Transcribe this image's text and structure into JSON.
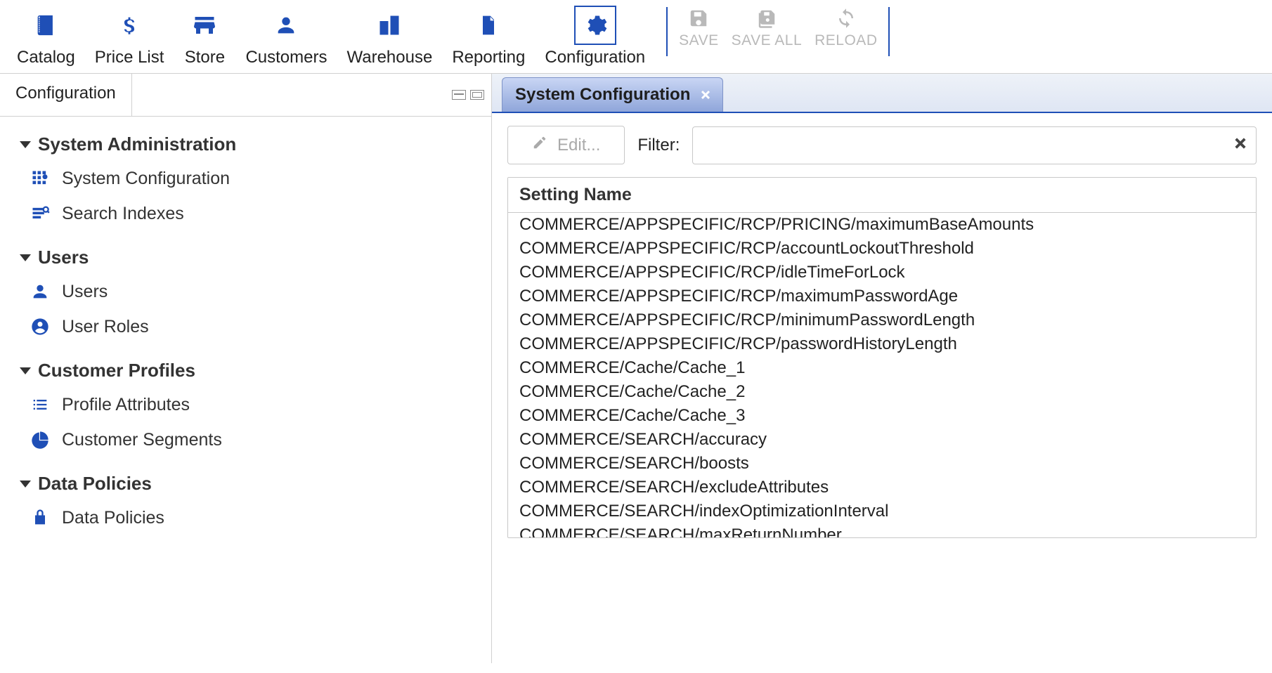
{
  "topnav": {
    "items": [
      {
        "label": "Catalog",
        "icon": "catalog-icon"
      },
      {
        "label": "Price List",
        "icon": "dollar-icon"
      },
      {
        "label": "Store",
        "icon": "store-icon"
      },
      {
        "label": "Customers",
        "icon": "person-icon"
      },
      {
        "label": "Warehouse",
        "icon": "building-icon"
      },
      {
        "label": "Reporting",
        "icon": "document-icon"
      },
      {
        "label": "Configuration",
        "icon": "gear-icon",
        "active": true
      }
    ]
  },
  "actions": {
    "save": "SAVE",
    "save_all": "SAVE ALL",
    "reload": "RELOAD"
  },
  "left": {
    "tab_label": "Configuration",
    "sections": [
      {
        "label": "System Administration",
        "items": [
          {
            "label": "System Configuration",
            "icon": "grid-gear-icon"
          },
          {
            "label": "Search Indexes",
            "icon": "index-search-icon"
          }
        ]
      },
      {
        "label": "Users",
        "items": [
          {
            "label": "Users",
            "icon": "person-icon"
          },
          {
            "label": "User Roles",
            "icon": "account-circle-icon"
          }
        ]
      },
      {
        "label": "Customer Profiles",
        "items": [
          {
            "label": "Profile Attributes",
            "icon": "attributes-icon"
          },
          {
            "label": "Customer Segments",
            "icon": "pie-chart-icon"
          }
        ]
      },
      {
        "label": "Data Policies",
        "items": [
          {
            "label": "Data Policies",
            "icon": "lock-icon"
          }
        ]
      }
    ]
  },
  "right": {
    "tab_label": "System Configuration",
    "edit_label": "Edit...",
    "filter_label": "Filter:",
    "filter_value": "",
    "grid_header": "Setting Name",
    "rows": [
      "COMMERCE/APPSPECIFIC/RCP/PRICING/maximumBaseAmounts",
      "COMMERCE/APPSPECIFIC/RCP/accountLockoutThreshold",
      "COMMERCE/APPSPECIFIC/RCP/idleTimeForLock",
      "COMMERCE/APPSPECIFIC/RCP/maximumPasswordAge",
      "COMMERCE/APPSPECIFIC/RCP/minimumPasswordLength",
      "COMMERCE/APPSPECIFIC/RCP/passwordHistoryLength",
      "COMMERCE/Cache/Cache_1",
      "COMMERCE/Cache/Cache_2",
      "COMMERCE/Cache/Cache_3",
      "COMMERCE/SEARCH/accuracy",
      "COMMERCE/SEARCH/boosts",
      "COMMERCE/SEARCH/excludeAttributes",
      "COMMERCE/SEARCH/indexOptimizationInterval",
      "COMMERCE/SEARCH/maxReturnNumber"
    ]
  }
}
